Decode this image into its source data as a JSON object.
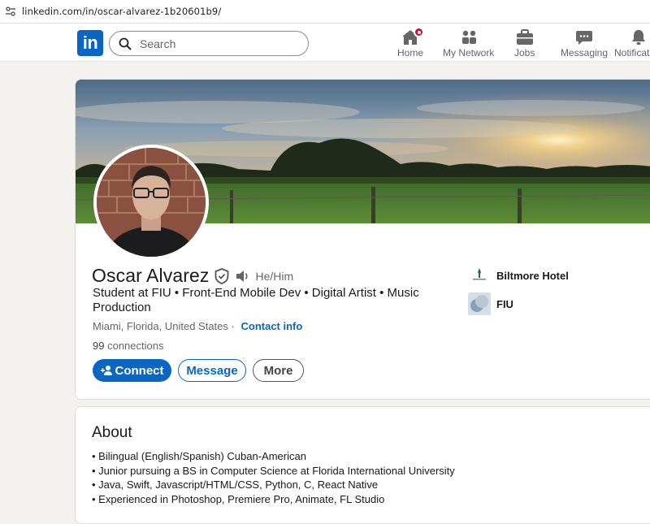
{
  "browser": {
    "url": "linkedin.com/in/oscar-alvarez-1b20601b9/"
  },
  "nav": {
    "logo": "in",
    "search_placeholder": "Search",
    "items": [
      {
        "label": "Home",
        "icon": "home-icon"
      },
      {
        "label": "My Network",
        "icon": "network-icon"
      },
      {
        "label": "Jobs",
        "icon": "briefcase-icon"
      },
      {
        "label": "Messaging",
        "icon": "messaging-icon"
      },
      {
        "label": "Notifications",
        "icon": "bell-icon"
      }
    ]
  },
  "profile": {
    "name": "Oscar Alvarez",
    "pronouns": "He/Him",
    "headline": "Student at FIU • Front-End Mobile Dev • Digital Artist • Music Production",
    "location": "Miami, Florida, United States",
    "separator": "·",
    "contact_info": "Contact info",
    "connections_count": "99",
    "connections_label": "connections",
    "buttons": {
      "connect": "Connect",
      "message": "Message",
      "more": "More"
    },
    "organizations": [
      {
        "name": "Biltmore Hotel"
      },
      {
        "name": "FIU"
      }
    ]
  },
  "about": {
    "title": "About",
    "items": [
      "• Bilingual (English/Spanish) Cuban-American",
      "• Junior pursuing a BS in Computer Science at Florida International University",
      "• Java, Swift, Javascript/HTML/CSS, Python, C, React Native",
      "• Experienced in Photoshop, Premiere Pro, Animate, FL Studio"
    ]
  },
  "colors": {
    "brand": "#0a66c2",
    "notification_badge": "#cb112d",
    "page_bg": "#f4f2ee"
  }
}
